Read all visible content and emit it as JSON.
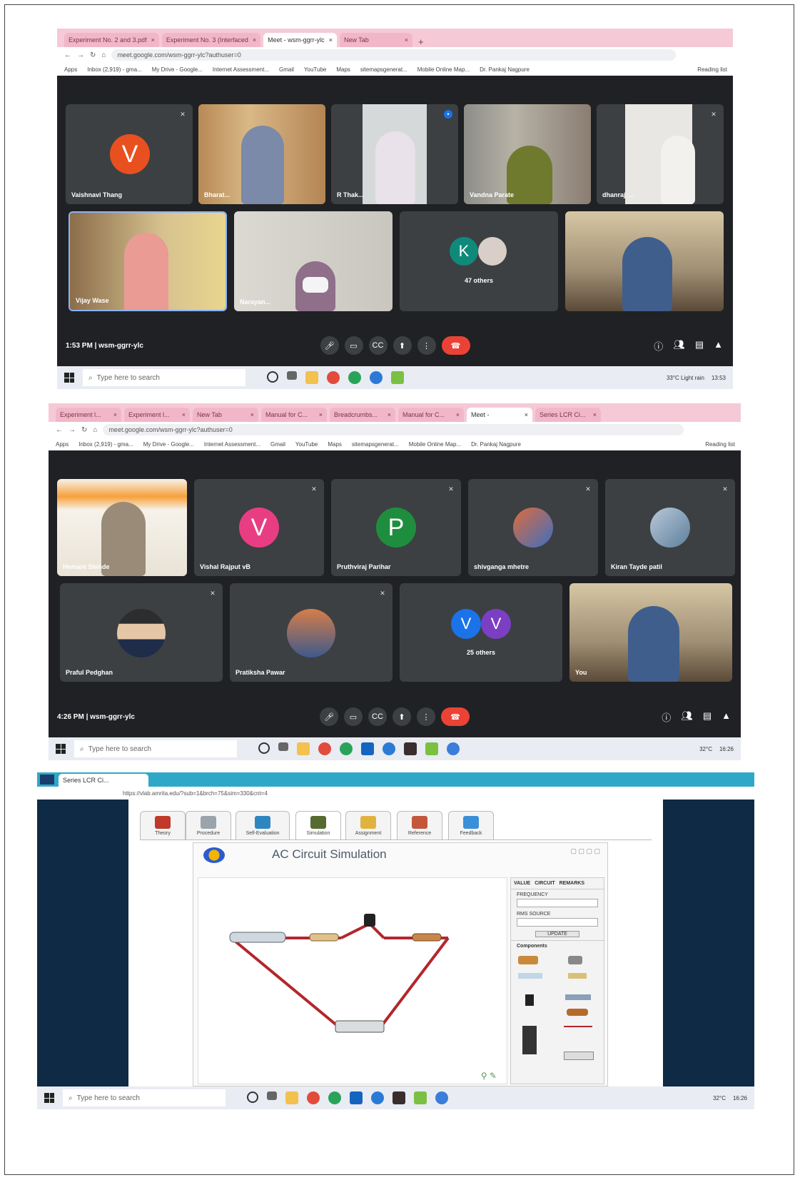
{
  "screens": [
    {
      "tabs": [
        "Experiment No. 2 and 3.pdf",
        "Experiment No. 3 (Interfaced",
        "Meet - wsm-ggrr-ylc",
        "New Tab"
      ],
      "url": "meet.google.com/wsm-ggrr-ylc?authuser=0",
      "bookmarks": [
        "Apps",
        "Inbox (2,919) - gma...",
        "My Drive - Google...",
        "Internet Assessment...",
        "Gmail",
        "YouTube",
        "Maps",
        "sitemapsgenerat...",
        "Mobile Online Map...",
        "Dr. Pankaj Nagpure",
        "Reading list"
      ],
      "participants": [
        "Vaishnavi Thang",
        "Bharat...",
        "R Thak...",
        "Vandna Parate",
        "dhanraj_...",
        "Vijay Wase",
        "Narayan...",
        "47 others",
        ""
      ],
      "others_badge": "K",
      "time": "1:53 PM",
      "meeting_code": "wsm-ggrr-ylc",
      "search_placeholder": "Type here to search",
      "tray": "33°C Light rain",
      "clock": "13:53"
    },
    {
      "tabs": [
        "Experiment l...",
        "Experiment l...",
        "New Tab",
        "Manual for C...",
        "Breadcrumbs...",
        "Manual for C...",
        "Meet -",
        "Series LCR Ci..."
      ],
      "url": "meet.google.com/wsm-ggrr-ylc?authuser=0",
      "bookmarks": [
        "Apps",
        "Inbox (2,919) - gma...",
        "My Drive - Google...",
        "Internet Assessment...",
        "Gmail",
        "YouTube",
        "Maps",
        "sitemapsgenerat...",
        "Mobile Online Map...",
        "Dr. Pankaj Nagpure",
        "Reading list"
      ],
      "participants": [
        "Hemant Shinde",
        "Vishal Rajput vB",
        "Pruthviraj Parihar",
        "shivganga mhetre",
        "Kiran Tayde patil",
        "Praful Pedghan",
        "Pratiksha Pawar",
        "25 others",
        "You"
      ],
      "avatars": {
        "v1": "V",
        "p": "P",
        "v2": "V",
        "v3": "V"
      },
      "time": "4:26 PM",
      "meeting_code": "wsm-ggrr-ylc",
      "search_placeholder": "Type here to search",
      "tray": "32°C",
      "clock": "16:26"
    }
  ],
  "vlab": {
    "tab": "Series LCR Ci...",
    "url": "https://vlab.amrita.edu/?sub=1&brch=75&sim=330&cnt=4",
    "tabs": [
      "Theory",
      "Procedure",
      "Self-Evaluation",
      "Simulation",
      "Assignment",
      "Reference",
      "Feedback"
    ],
    "sim_title": "AC Circuit Simulation",
    "panel_tabs": [
      "VALUE",
      "CIRCUIT",
      "REMARKS"
    ],
    "fields": [
      "FREQUENCY",
      "RMS SOURCE",
      "UPDATE"
    ],
    "components_label": "Components",
    "search_placeholder": "Type here to search",
    "tray": "32°C",
    "clock": "16:26"
  },
  "colors": {
    "avatar_v_orange": "#e8511f",
    "avatar_k_teal": "#0f8a7a",
    "avatar_v_pink": "#e93d83",
    "avatar_p_green": "#1e8e3e",
    "avatar_v_blue": "#1a73e8",
    "avatar_v_purple": "#7b3fc4",
    "end_call": "#ea4335",
    "wire": "#b3262d"
  }
}
